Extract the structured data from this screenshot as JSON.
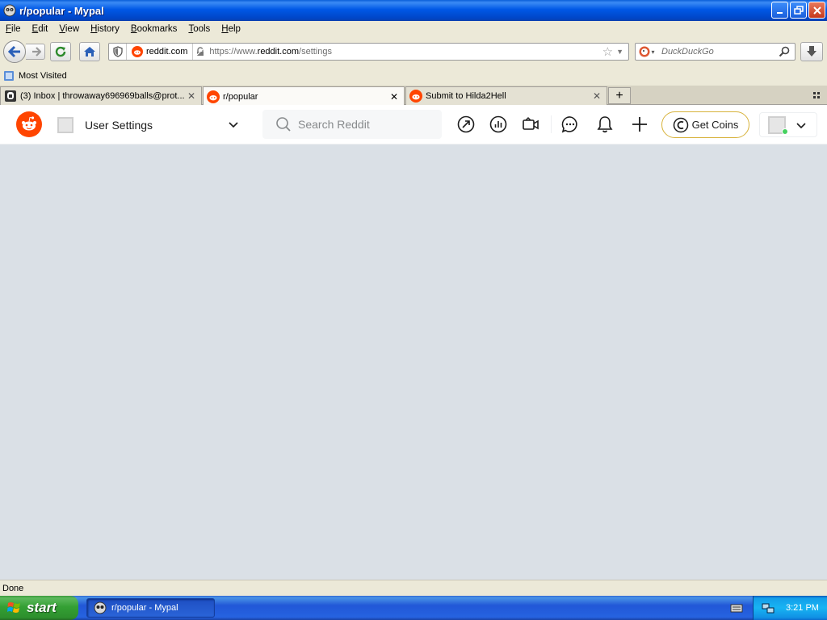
{
  "window": {
    "title": "r/popular - Mypal"
  },
  "menu": [
    "File",
    "Edit",
    "View",
    "History",
    "Bookmarks",
    "Tools",
    "Help"
  ],
  "menu_access": [
    "F",
    "E",
    "V",
    "H",
    "B",
    "T",
    "H"
  ],
  "nav": {
    "site_label": "reddit.com",
    "url_prefix": "https://www.",
    "url_host": "reddit.com",
    "url_path": "/settings",
    "search_placeholder": "DuckDuckGo"
  },
  "bookmarks": {
    "most_visited": "Most Visited"
  },
  "tabs": [
    {
      "label": "(3) Inbox | throwaway696969balls@prot...",
      "active": false
    },
    {
      "label": "r/popular",
      "active": true
    },
    {
      "label": "Submit to Hilda2Hell",
      "active": false
    }
  ],
  "reddit": {
    "community_title": "User Settings",
    "search_placeholder": "Search Reddit",
    "coins_label": "Get Coins",
    "accent_color": "#ff4500",
    "background_color": "#dae0e6"
  },
  "status": {
    "text": "Done"
  },
  "taskbar": {
    "start_label": "start",
    "task_label": "r/popular - Mypal",
    "clock": "3:21 PM"
  }
}
